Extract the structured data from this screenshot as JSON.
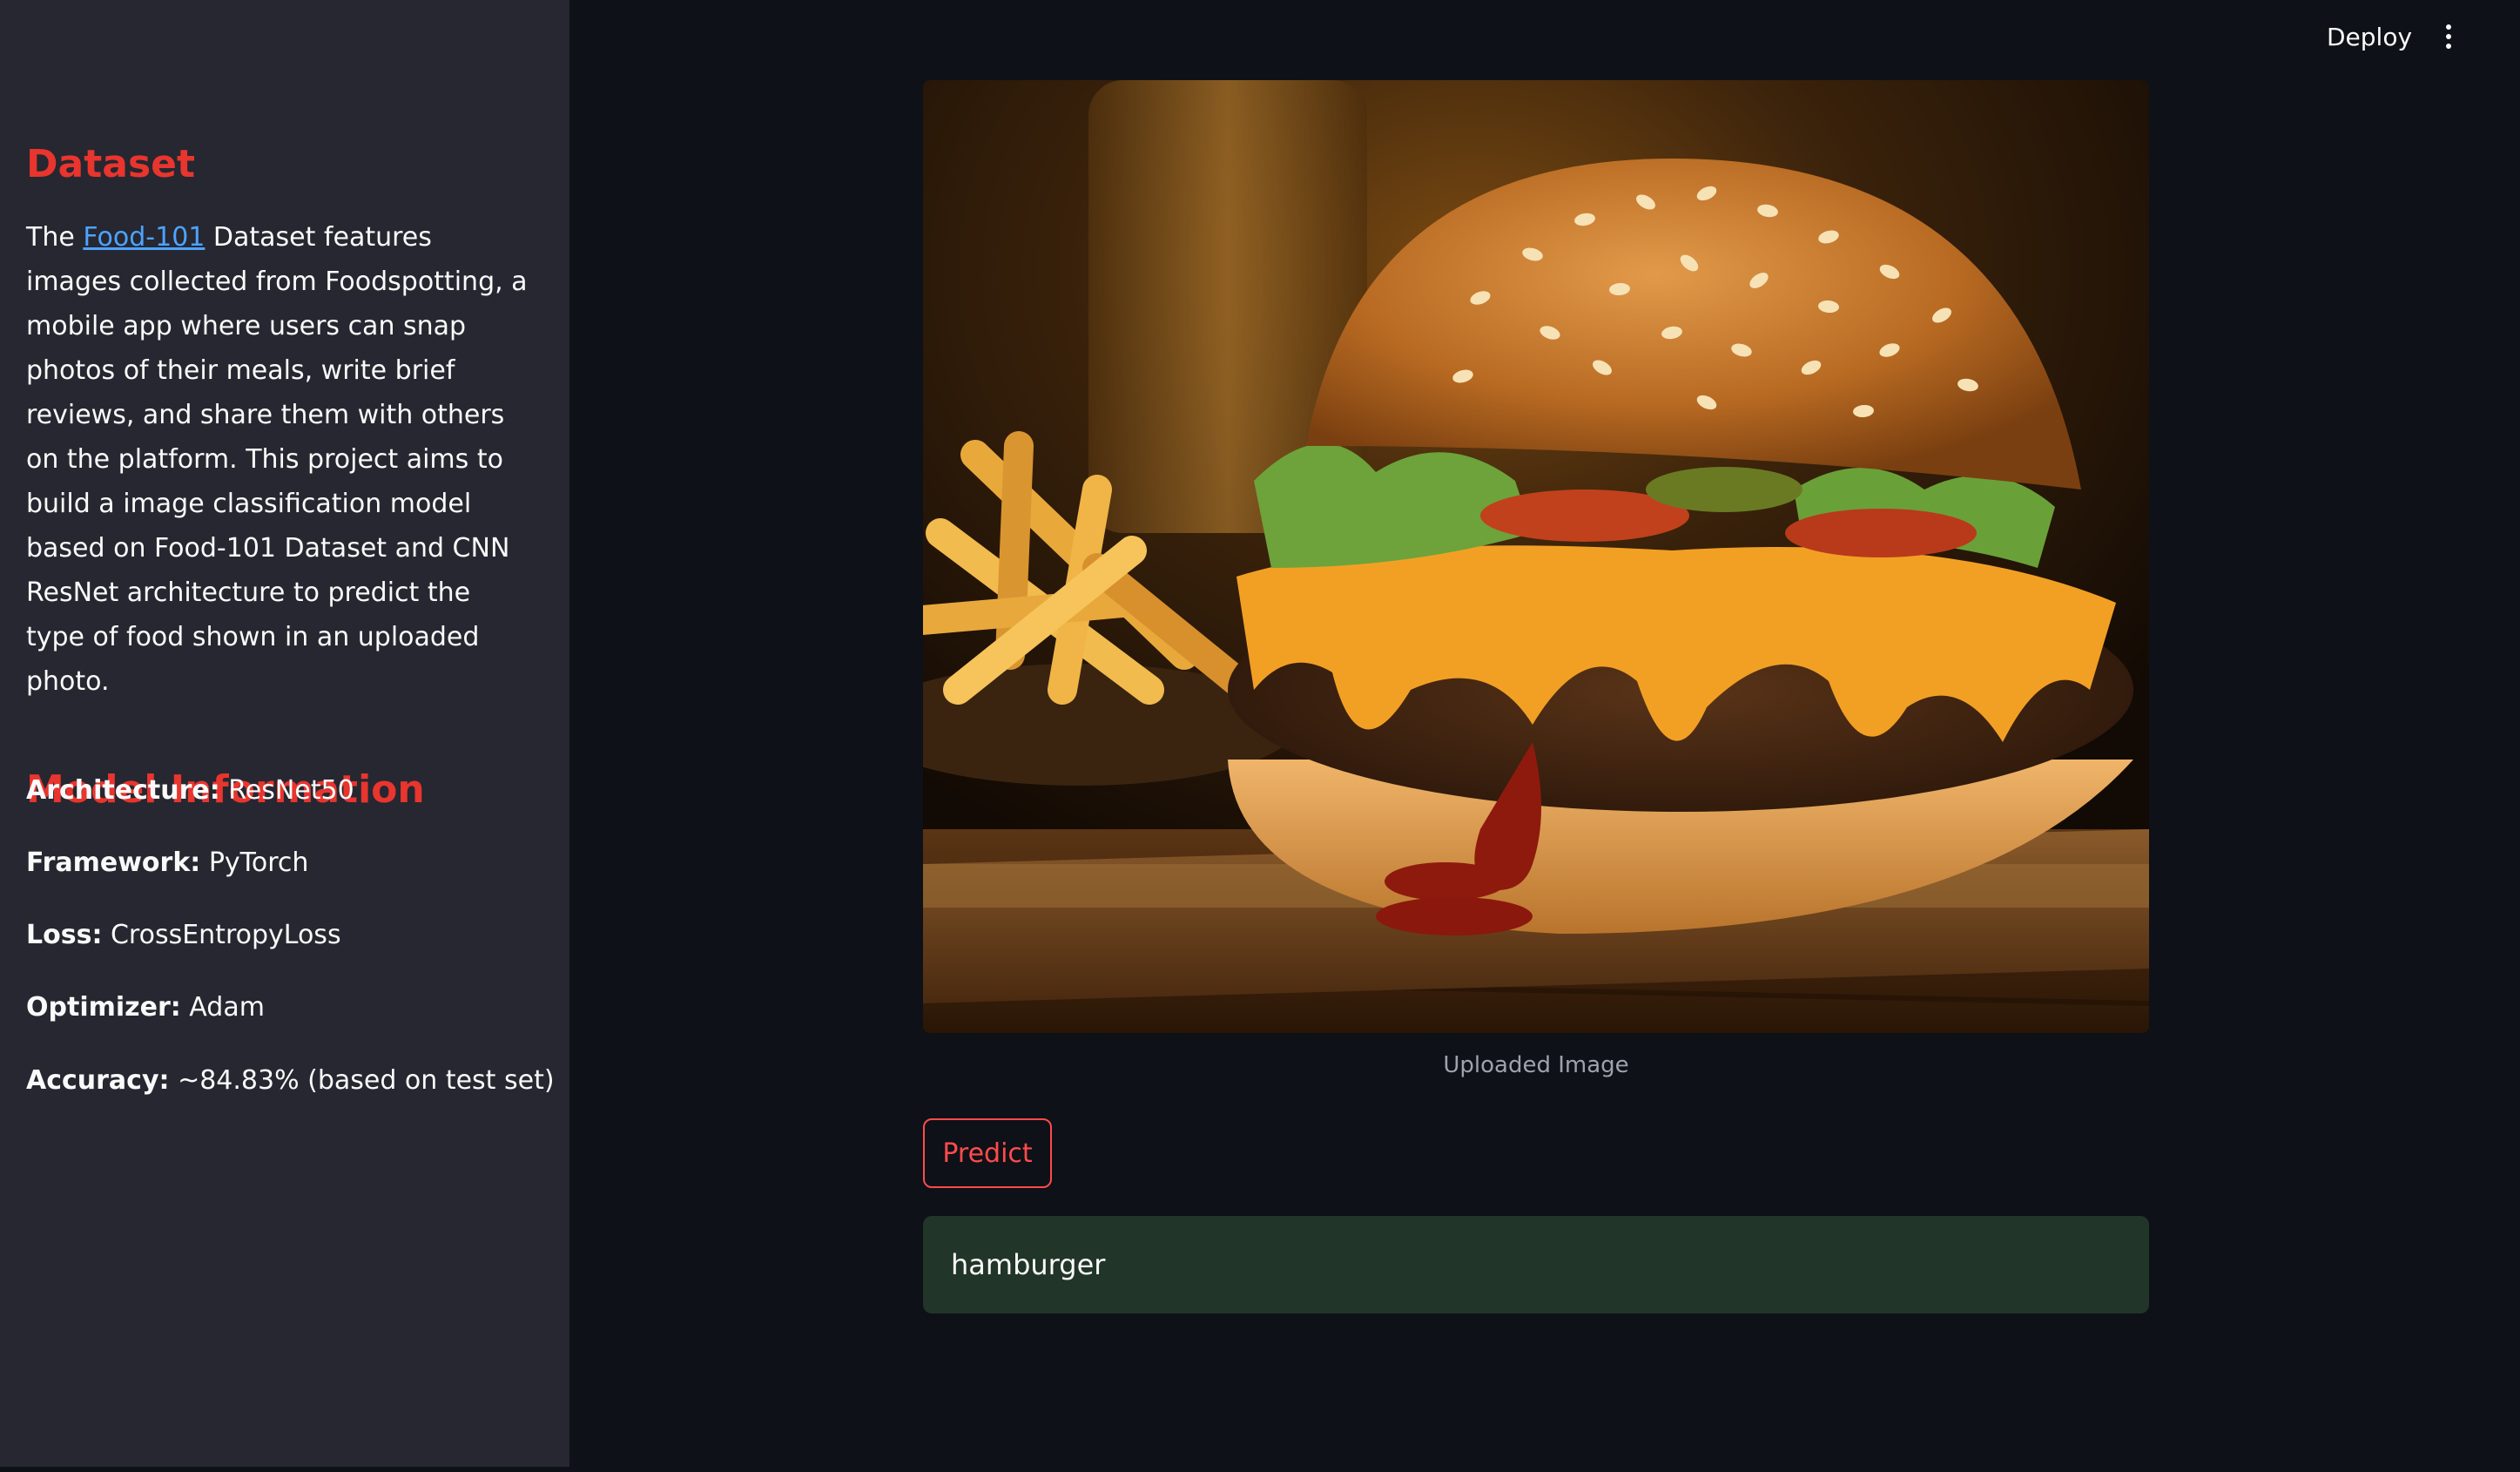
{
  "header": {
    "deploy_label": "Deploy",
    "menu_icon": "more-vert-icon"
  },
  "sidebar": {
    "dataset_heading": "Dataset",
    "dataset_text_prefix": "The ",
    "dataset_link": "Food-101",
    "dataset_text_suffix": " Dataset features images collected from Foodspotting, a mobile app where users can snap photos of their meals, write brief reviews, and share them with others on the platform. This project aims to build a image classification model based on Food-101 Dataset and CNN ResNet architecture to predict the type of food shown in an uploaded photo.",
    "model_heading": "Model Information",
    "model_info": [
      {
        "label": "Architecture:",
        "value": " ResNet50"
      },
      {
        "label": "Framework:",
        "value": " PyTorch"
      },
      {
        "label": "Loss:",
        "value": " CrossEntropyLoss"
      },
      {
        "label": "Optimizer:",
        "value": " Adam"
      },
      {
        "label": "Accuracy:",
        "value": " ~84.83% (based on test set)"
      }
    ]
  },
  "main": {
    "image_caption": "Uploaded Image",
    "predict_label": "Predict",
    "prediction_result": "hamburger"
  },
  "colors": {
    "accent": "#e8352e",
    "sidebar_bg": "#262730",
    "main_bg": "#0e1117",
    "result_bg": "#213528",
    "link": "#4da3ff"
  }
}
